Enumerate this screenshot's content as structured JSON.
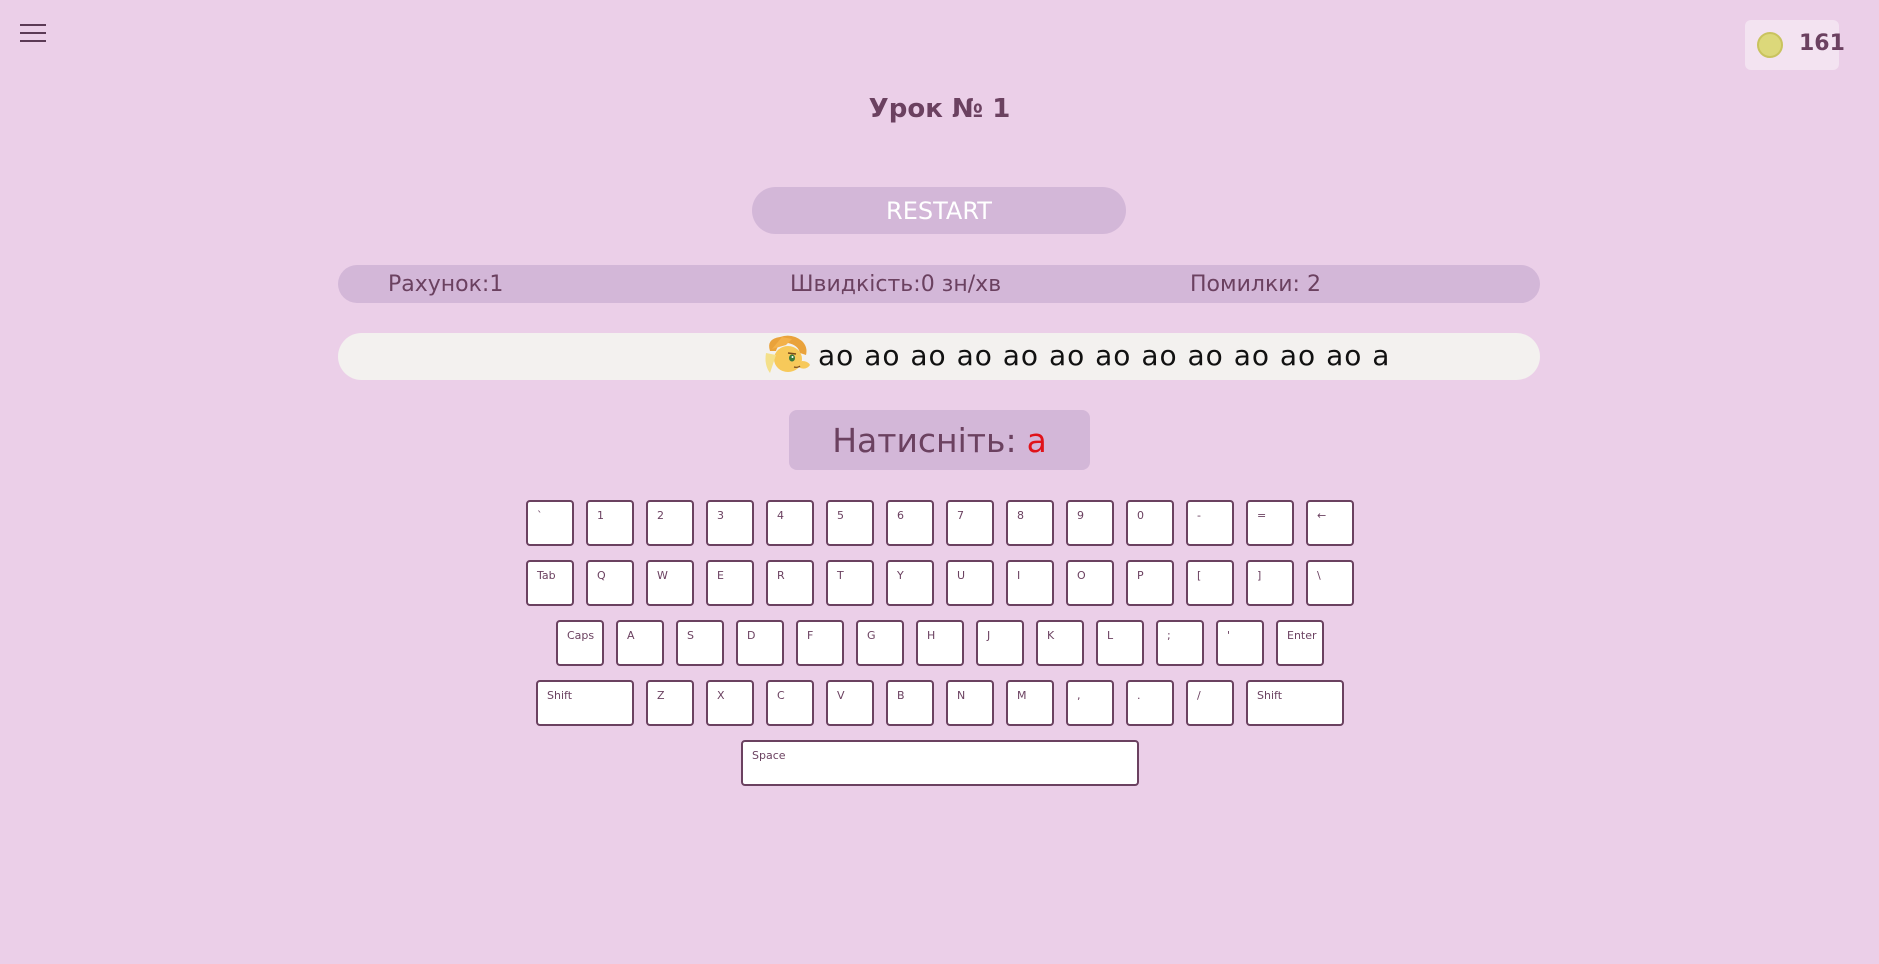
{
  "header": {
    "menu_icon": "hamburger-menu-icon",
    "coins": {
      "icon": "coin-icon",
      "count": "161"
    }
  },
  "lesson": {
    "title": "Урок № 1"
  },
  "restart_label": "RESTART",
  "stats": {
    "score": "Рахунок:1",
    "speed": "Швидкість:0 зн/хв",
    "errors": "Помилки: 2"
  },
  "track": {
    "character_icon": "pony-character-icon",
    "text": "ao ao ao ao ao ao ao ao ao ao ao ao a"
  },
  "prompt": {
    "label": "Натисніть:",
    "target": "a",
    "target_color": "#e0131a"
  },
  "keyboard": {
    "rows": [
      [
        "`",
        "1",
        "2",
        "3",
        "4",
        "5",
        "6",
        "7",
        "8",
        "9",
        "0",
        "-",
        "=",
        "←"
      ],
      [
        "Tab",
        "Q",
        "W",
        "E",
        "R",
        "T",
        "Y",
        "U",
        "I",
        "O",
        "P",
        "[",
        "]",
        "\\"
      ],
      [
        "Caps",
        "A",
        "S",
        "D",
        "F",
        "G",
        "H",
        "J",
        "K",
        "L",
        ";",
        "'",
        "Enter"
      ],
      [
        "Shift",
        "Z",
        "X",
        "C",
        "V",
        "B",
        "N",
        "M",
        ",",
        ".",
        "/",
        "Shift"
      ],
      [
        "Space"
      ]
    ]
  },
  "colors": {
    "background": "#ebcfe8",
    "panel": "#d3b7d8",
    "text": "#6b4160",
    "key_border": "#6b4160"
  }
}
